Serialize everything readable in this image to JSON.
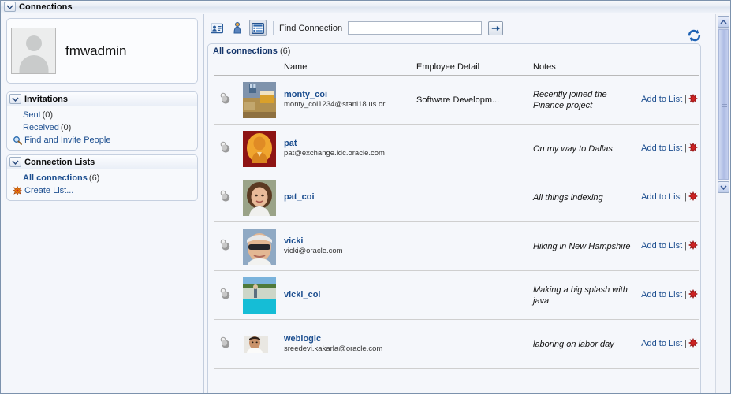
{
  "window": {
    "title": "Connections",
    "collapse_icon": "chevron-down-icon"
  },
  "profile": {
    "username": "fmwadmin",
    "avatar_alt": "default-user-avatar"
  },
  "sidebar": {
    "invitations": {
      "title": "Invitations",
      "items": [
        {
          "label": "Sent",
          "count": "(0)",
          "icon": null
        },
        {
          "label": "Received",
          "count": "(0)",
          "icon": null
        },
        {
          "label": "Find and Invite People",
          "count": "",
          "icon": "magnifier-icon"
        }
      ]
    },
    "connection_lists": {
      "title": "Connection Lists",
      "items": [
        {
          "label": "All connections",
          "count": "(6)",
          "icon": null,
          "bold": true
        },
        {
          "label": "Create List...",
          "count": "",
          "icon": "create-list-icon"
        }
      ]
    }
  },
  "toolbar": {
    "buttons": [
      {
        "name": "card-view-button",
        "icon": "contact-card-icon",
        "selected": false
      },
      {
        "name": "people-view-button",
        "icon": "person-icon",
        "selected": false
      },
      {
        "name": "list-view-button",
        "icon": "list-view-icon",
        "selected": true
      }
    ],
    "find_label": "Find Connection",
    "find_value": "",
    "find_placeholder": "",
    "go_label": "",
    "refresh_icon": "refresh-icon"
  },
  "card": {
    "title": "All connections",
    "count": "(6)",
    "columns": [
      "Name",
      "Employee Detail",
      "Notes"
    ],
    "action_add": "Add to List",
    "action_sep": "|",
    "rows": [
      {
        "presence": "presence-offline-icon",
        "avatar": "avatar-bedroom-painting",
        "name": "monty_coi",
        "email": "monty_coi1234@stanl18.us.or...",
        "employee_detail": "Software Developm...",
        "notes": "Recently joined the Finance project"
      },
      {
        "presence": "presence-offline-icon",
        "avatar": "avatar-portrait-orange",
        "name": "pat",
        "email": "pat@exchange.idc.oracle.com",
        "employee_detail": "",
        "notes": "On my way to Dallas"
      },
      {
        "presence": "presence-offline-icon",
        "avatar": "avatar-woman-brown-hair",
        "name": "pat_coi",
        "email": "",
        "employee_detail": "",
        "notes": "All things indexing"
      },
      {
        "presence": "presence-offline-icon",
        "avatar": "avatar-woman-sunglasses",
        "name": "vicki",
        "email": "vicki@oracle.com",
        "employee_detail": "",
        "notes": "Hiking in New Hampshire"
      },
      {
        "presence": "presence-offline-icon",
        "avatar": "avatar-poolside",
        "name": "vicki_coi",
        "email": "",
        "employee_detail": "",
        "notes": "Making a big splash with java"
      },
      {
        "presence": "presence-offline-icon",
        "avatar": "avatar-man-face",
        "name": "weblogic",
        "email": "sreedevi.kakarla@oracle.com",
        "employee_detail": "",
        "notes": "laboring on labor day"
      }
    ]
  },
  "scrollbar": {
    "up_icon": "chevron-up-icon",
    "down_icon": "chevron-down-icon"
  },
  "colors": {
    "link": "#1c4e8f",
    "heading": "#14356b",
    "panel_bg": "#f5f7fb",
    "border": "#c6d0e0",
    "delete": "#cc2222"
  }
}
